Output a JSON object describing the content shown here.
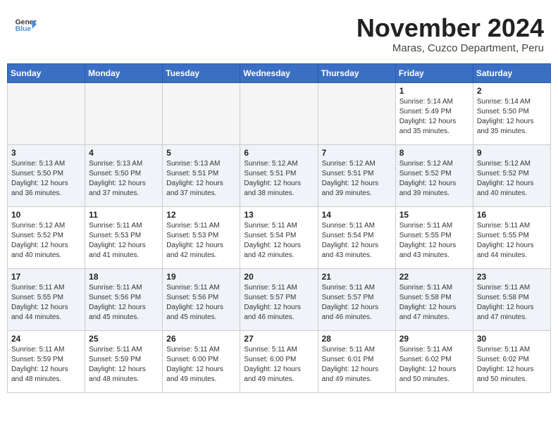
{
  "header": {
    "logo_line1": "General",
    "logo_line2": "Blue",
    "month": "November 2024",
    "location": "Maras, Cuzco Department, Peru"
  },
  "days_of_week": [
    "Sunday",
    "Monday",
    "Tuesday",
    "Wednesday",
    "Thursday",
    "Friday",
    "Saturday"
  ],
  "weeks": [
    [
      {
        "day": "",
        "info": ""
      },
      {
        "day": "",
        "info": ""
      },
      {
        "day": "",
        "info": ""
      },
      {
        "day": "",
        "info": ""
      },
      {
        "day": "",
        "info": ""
      },
      {
        "day": "1",
        "info": "Sunrise: 5:14 AM\nSunset: 5:49 PM\nDaylight: 12 hours and 35 minutes."
      },
      {
        "day": "2",
        "info": "Sunrise: 5:14 AM\nSunset: 5:50 PM\nDaylight: 12 hours and 35 minutes."
      }
    ],
    [
      {
        "day": "3",
        "info": "Sunrise: 5:13 AM\nSunset: 5:50 PM\nDaylight: 12 hours and 36 minutes."
      },
      {
        "day": "4",
        "info": "Sunrise: 5:13 AM\nSunset: 5:50 PM\nDaylight: 12 hours and 37 minutes."
      },
      {
        "day": "5",
        "info": "Sunrise: 5:13 AM\nSunset: 5:51 PM\nDaylight: 12 hours and 37 minutes."
      },
      {
        "day": "6",
        "info": "Sunrise: 5:12 AM\nSunset: 5:51 PM\nDaylight: 12 hours and 38 minutes."
      },
      {
        "day": "7",
        "info": "Sunrise: 5:12 AM\nSunset: 5:51 PM\nDaylight: 12 hours and 39 minutes."
      },
      {
        "day": "8",
        "info": "Sunrise: 5:12 AM\nSunset: 5:52 PM\nDaylight: 12 hours and 39 minutes."
      },
      {
        "day": "9",
        "info": "Sunrise: 5:12 AM\nSunset: 5:52 PM\nDaylight: 12 hours and 40 minutes."
      }
    ],
    [
      {
        "day": "10",
        "info": "Sunrise: 5:12 AM\nSunset: 5:52 PM\nDaylight: 12 hours and 40 minutes."
      },
      {
        "day": "11",
        "info": "Sunrise: 5:11 AM\nSunset: 5:53 PM\nDaylight: 12 hours and 41 minutes."
      },
      {
        "day": "12",
        "info": "Sunrise: 5:11 AM\nSunset: 5:53 PM\nDaylight: 12 hours and 42 minutes."
      },
      {
        "day": "13",
        "info": "Sunrise: 5:11 AM\nSunset: 5:54 PM\nDaylight: 12 hours and 42 minutes."
      },
      {
        "day": "14",
        "info": "Sunrise: 5:11 AM\nSunset: 5:54 PM\nDaylight: 12 hours and 43 minutes."
      },
      {
        "day": "15",
        "info": "Sunrise: 5:11 AM\nSunset: 5:55 PM\nDaylight: 12 hours and 43 minutes."
      },
      {
        "day": "16",
        "info": "Sunrise: 5:11 AM\nSunset: 5:55 PM\nDaylight: 12 hours and 44 minutes."
      }
    ],
    [
      {
        "day": "17",
        "info": "Sunrise: 5:11 AM\nSunset: 5:55 PM\nDaylight: 12 hours and 44 minutes."
      },
      {
        "day": "18",
        "info": "Sunrise: 5:11 AM\nSunset: 5:56 PM\nDaylight: 12 hours and 45 minutes."
      },
      {
        "day": "19",
        "info": "Sunrise: 5:11 AM\nSunset: 5:56 PM\nDaylight: 12 hours and 45 minutes."
      },
      {
        "day": "20",
        "info": "Sunrise: 5:11 AM\nSunset: 5:57 PM\nDaylight: 12 hours and 46 minutes."
      },
      {
        "day": "21",
        "info": "Sunrise: 5:11 AM\nSunset: 5:57 PM\nDaylight: 12 hours and 46 minutes."
      },
      {
        "day": "22",
        "info": "Sunrise: 5:11 AM\nSunset: 5:58 PM\nDaylight: 12 hours and 47 minutes."
      },
      {
        "day": "23",
        "info": "Sunrise: 5:11 AM\nSunset: 5:58 PM\nDaylight: 12 hours and 47 minutes."
      }
    ],
    [
      {
        "day": "24",
        "info": "Sunrise: 5:11 AM\nSunset: 5:59 PM\nDaylight: 12 hours and 48 minutes."
      },
      {
        "day": "25",
        "info": "Sunrise: 5:11 AM\nSunset: 5:59 PM\nDaylight: 12 hours and 48 minutes."
      },
      {
        "day": "26",
        "info": "Sunrise: 5:11 AM\nSunset: 6:00 PM\nDaylight: 12 hours and 49 minutes."
      },
      {
        "day": "27",
        "info": "Sunrise: 5:11 AM\nSunset: 6:00 PM\nDaylight: 12 hours and 49 minutes."
      },
      {
        "day": "28",
        "info": "Sunrise: 5:11 AM\nSunset: 6:01 PM\nDaylight: 12 hours and 49 minutes."
      },
      {
        "day": "29",
        "info": "Sunrise: 5:11 AM\nSunset: 6:02 PM\nDaylight: 12 hours and 50 minutes."
      },
      {
        "day": "30",
        "info": "Sunrise: 5:11 AM\nSunset: 6:02 PM\nDaylight: 12 hours and 50 minutes."
      }
    ]
  ]
}
